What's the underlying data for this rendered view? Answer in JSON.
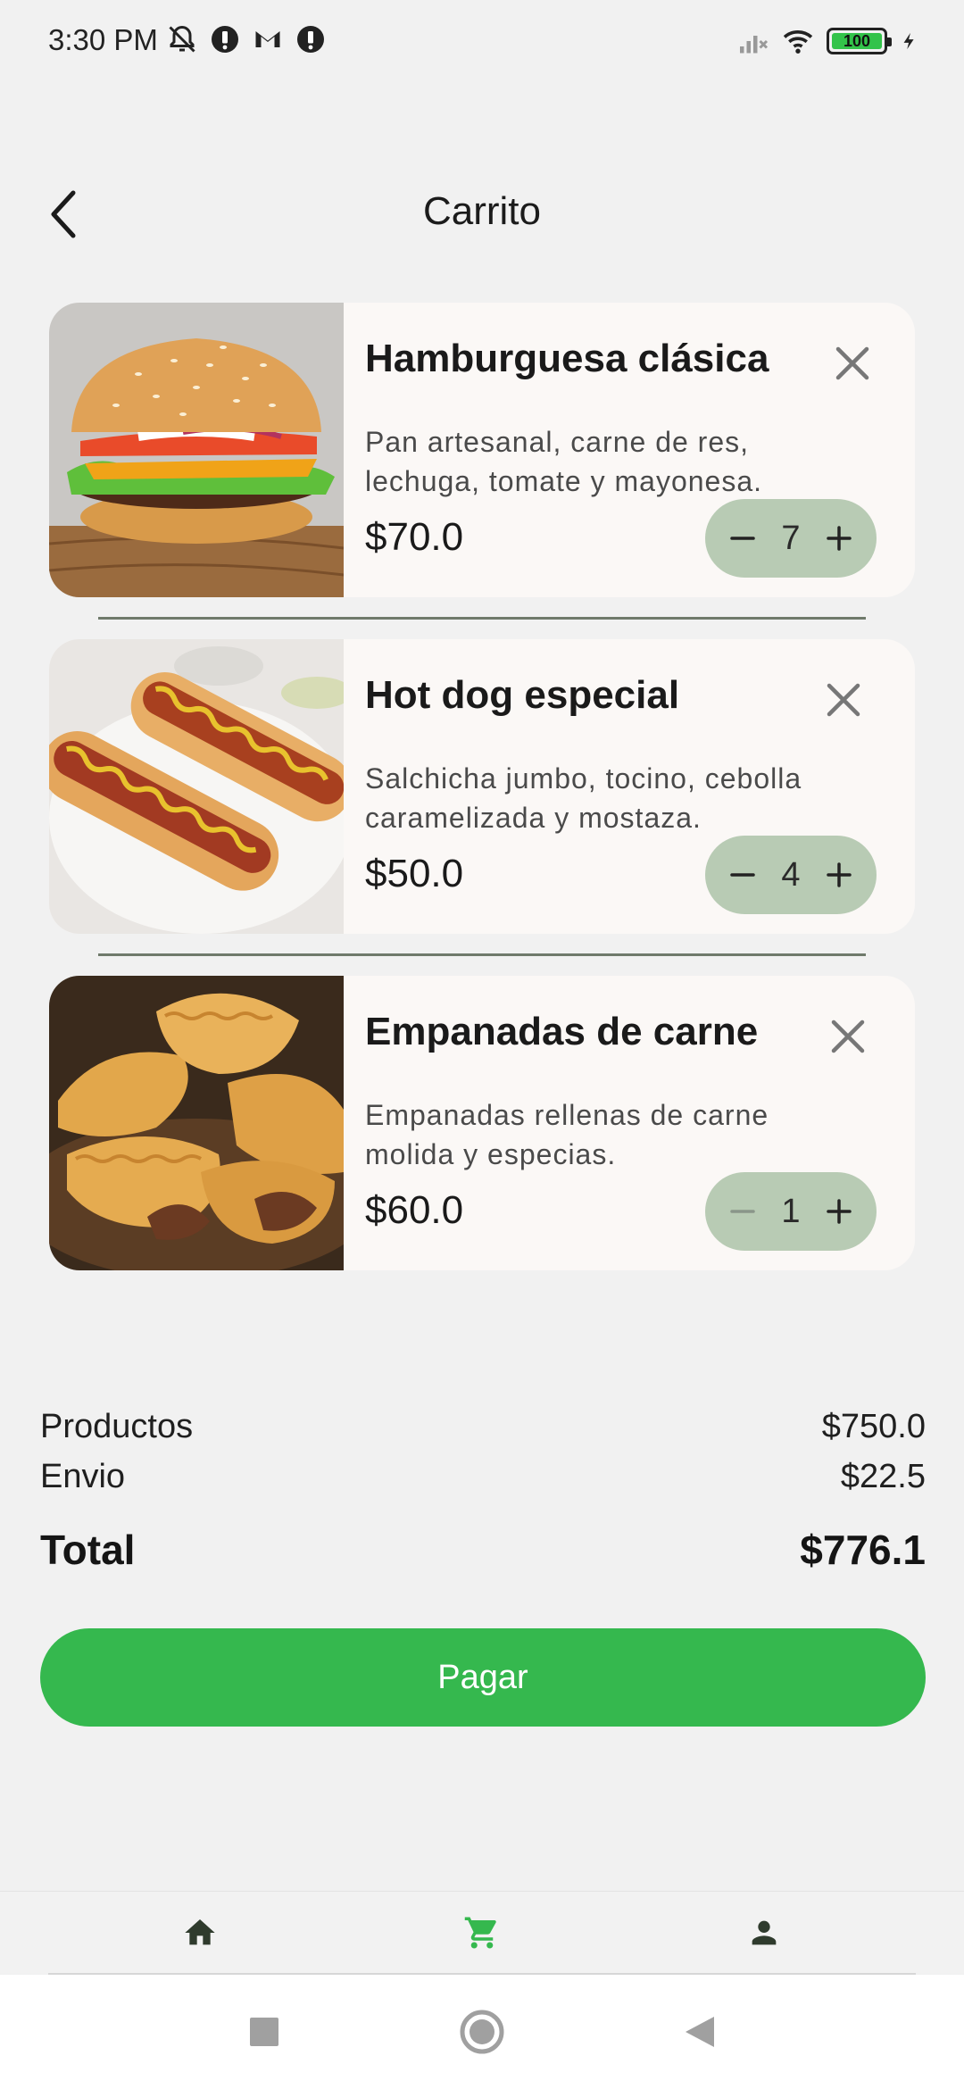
{
  "status_bar": {
    "time": "3:30 PM",
    "battery": "100",
    "icons": [
      "muted-bell-icon",
      "notification-icon",
      "gmail-icon",
      "notification-icon",
      "signal-icon",
      "wifi-icon",
      "battery-icon",
      "charging-icon"
    ]
  },
  "header": {
    "title": "Carrito",
    "back_icon": "chevron-left-icon"
  },
  "cart": {
    "items": [
      {
        "name": "Hamburguesa clásica",
        "description": "Pan artesanal, carne de res, lechuga, tomate y mayonesa.",
        "price": "$70.0",
        "quantity": "7",
        "image": "burger-photo"
      },
      {
        "name": "Hot dog especial",
        "description": "Salchicha jumbo, tocino, cebolla caramelizada y mostaza.",
        "price": "$50.0",
        "quantity": "4",
        "image": "hotdog-photo"
      },
      {
        "name": "Empanadas de carne",
        "description": "Empanadas rellenas de carne molida y especias.",
        "price": "$60.0",
        "quantity": "1",
        "image": "empanadas-photo"
      }
    ]
  },
  "summary": {
    "products_label": "Productos",
    "products_value": "$750.0",
    "shipping_label": "Envio",
    "shipping_value": "$22.5",
    "total_label": "Total",
    "total_value": "$776.1"
  },
  "pay_button": {
    "label": "Pagar"
  },
  "bottom_nav": {
    "items": [
      "home-icon",
      "cart-icon",
      "person-icon"
    ],
    "active": "cart-icon",
    "active_color": "#35b84e",
    "inactive_color": "#2f3b2d"
  },
  "colors": {
    "accent": "#35b84e",
    "stepper": "#b8cbb4",
    "card": "#fbf8f6",
    "background": "#f1f1f1"
  }
}
